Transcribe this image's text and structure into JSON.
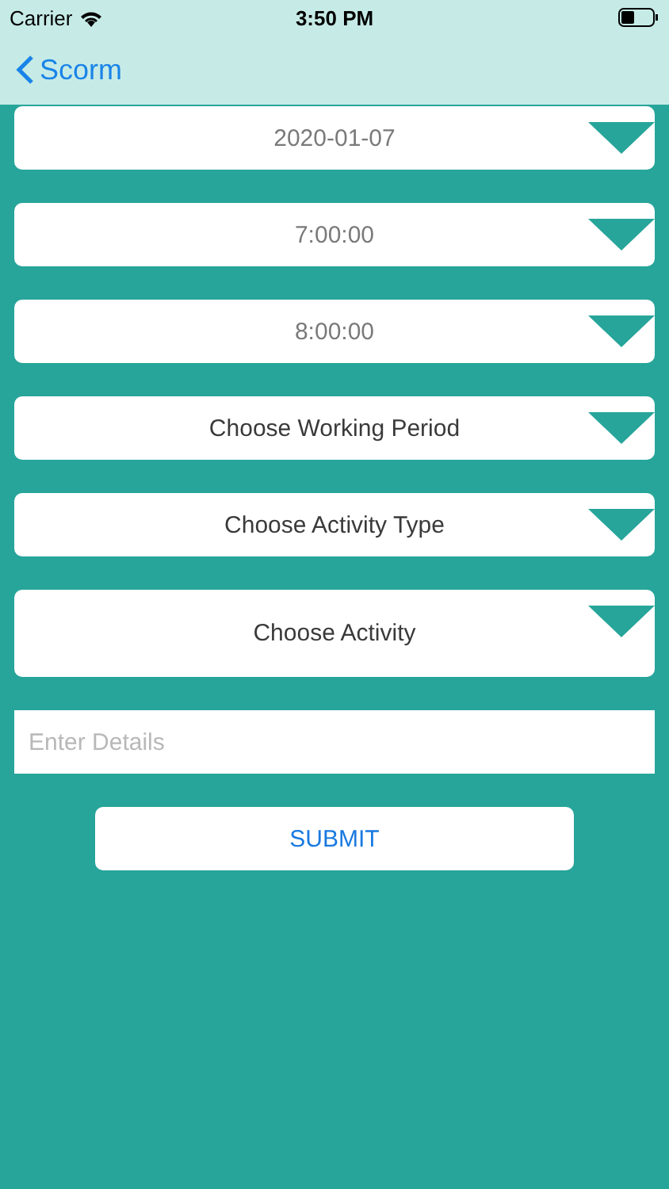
{
  "status_bar": {
    "carrier": "Carrier",
    "time": "3:50 PM"
  },
  "nav_bar": {
    "back_label": "Scorm"
  },
  "dropdowns": [
    {
      "kind": "value",
      "text": "2020-01-07"
    },
    {
      "kind": "value",
      "text": "7:00:00"
    },
    {
      "kind": "value",
      "text": "8:00:00"
    },
    {
      "kind": "prompt",
      "text": "Choose Working Period"
    },
    {
      "kind": "prompt",
      "text": "Choose Activity Type"
    },
    {
      "kind": "tall",
      "text": "Choose Activity"
    }
  ],
  "details_field": {
    "placeholder": "Enter Details"
  },
  "submit_button": "SUBMIT"
}
